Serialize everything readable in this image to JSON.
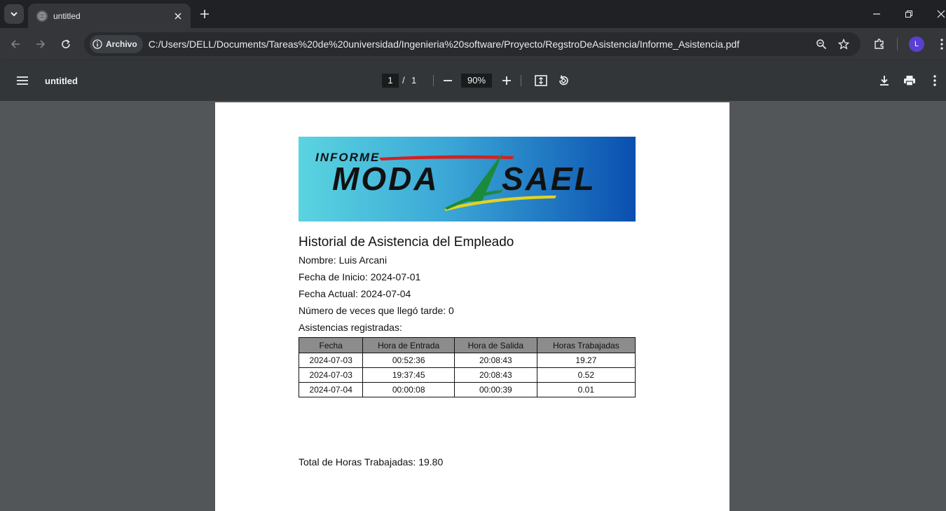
{
  "browser": {
    "tab_title": "untitled",
    "site_chip_label": "Archivo",
    "url": "C:/Users/DELL/Documents/Tareas%20de%20universidad/Ingenieria%20software/Proyecto/RegstroDeAsistencia/Informe_Asistencia.pdf",
    "profile_initial": "L",
    "profile_color": "#5b3fd0"
  },
  "pdf_viewer": {
    "title": "untitled",
    "current_page": "1",
    "page_separator": "/",
    "total_pages": "1",
    "zoom": "90%"
  },
  "document": {
    "logo": {
      "word_top": "INFORME",
      "word_left": "MODA",
      "word_right": "SAEL"
    },
    "heading": "Historial de Asistencia del Empleado",
    "nombre": "Nombre: Luis Arcani",
    "fecha_inicio": "Fecha de Inicio: 2024-07-01",
    "fecha_actual": "Fecha Actual: 2024-07-04",
    "tardanzas": "Número de veces que llegó tarde: 0",
    "asistencias_label": "Asistencias registradas:",
    "table": {
      "headers": [
        "Fecha",
        "Hora de Entrada",
        "Hora de Salida",
        "Horas Trabajadas"
      ],
      "rows": [
        [
          "2024-07-03",
          "00:52:36",
          "20:08:43",
          "19.27"
        ],
        [
          "2024-07-03",
          "19:37:45",
          "20:08:43",
          "0.52"
        ],
        [
          "2024-07-04",
          "00:00:08",
          "00:00:39",
          "0.01"
        ]
      ]
    },
    "total": "Total de Horas Trabajadas: 19.80"
  }
}
